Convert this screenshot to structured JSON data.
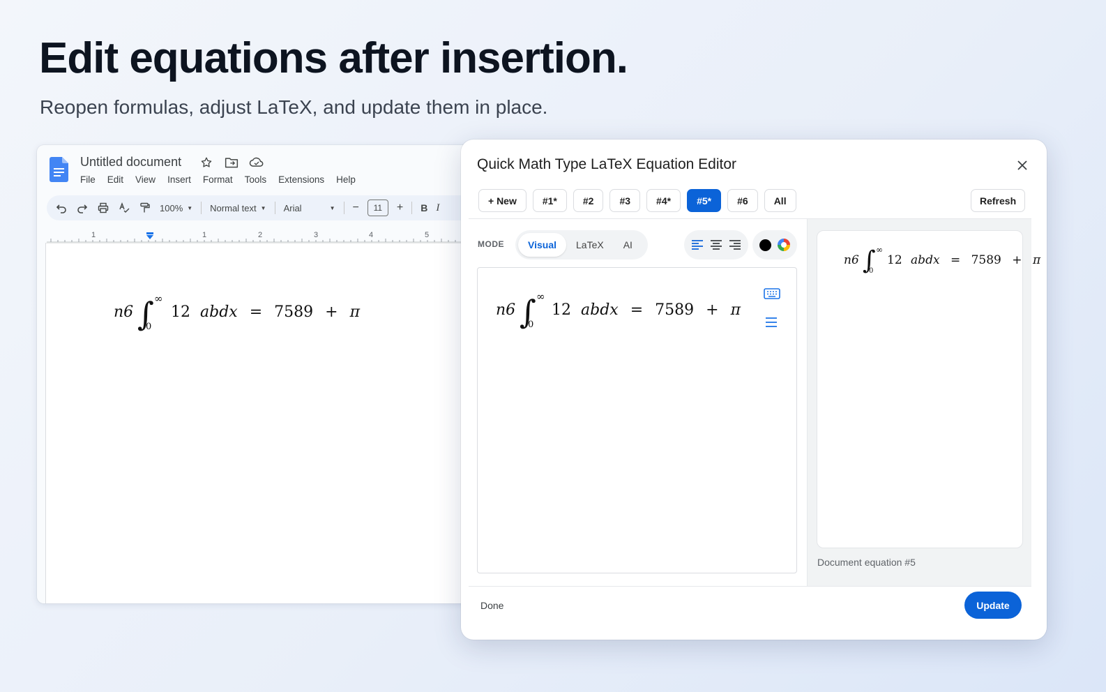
{
  "hero": {
    "headline": "Edit equations after insertion.",
    "subhead": "Reopen formulas, adjust LaTeX, and update them in place."
  },
  "docs": {
    "title": "Untitled document",
    "menu": [
      "File",
      "Edit",
      "View",
      "Insert",
      "Format",
      "Tools",
      "Extensions",
      "Help"
    ],
    "toolbar": {
      "zoom": "100%",
      "style": "Normal text",
      "font": "Arial",
      "font_size": "11",
      "minus": "−",
      "plus": "+",
      "bold": "B",
      "italic": "I"
    },
    "ruler_numbers": [
      "1",
      "1",
      "2",
      "3",
      "4",
      "5"
    ]
  },
  "equation": {
    "lead": "n6",
    "integral_sign": "∫",
    "upper_limit": "∞",
    "lower_limit": "0",
    "coef": "12",
    "body": "abdx",
    "equals": "=",
    "rhs_number": "7589",
    "plus": "+",
    "pi": "π"
  },
  "editor": {
    "title": "Quick Math Type LaTeX Equation Editor",
    "tabs": [
      {
        "label": "+ New",
        "active": false
      },
      {
        "label": "#1*",
        "active": false
      },
      {
        "label": "#2",
        "active": false
      },
      {
        "label": "#3",
        "active": false
      },
      {
        "label": "#4*",
        "active": false
      },
      {
        "label": "#5*",
        "active": true
      },
      {
        "label": "#6",
        "active": false
      },
      {
        "label": "All",
        "active": false
      }
    ],
    "refresh_label": "Refresh",
    "mode_label": "MODE",
    "modes": [
      "Visual",
      "LaTeX",
      "AI"
    ],
    "active_mode": "Visual",
    "preview_caption": "Document equation #5",
    "done_label": "Done",
    "update_label": "Update"
  },
  "colors": {
    "accent": "#0b63d8",
    "docs_blue": "#4285f4"
  }
}
